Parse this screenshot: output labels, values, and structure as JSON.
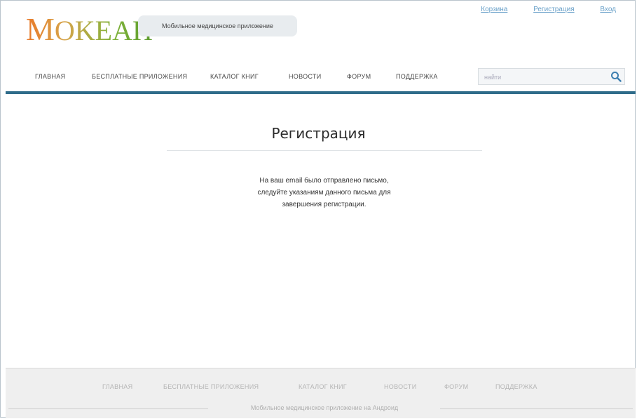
{
  "header": {
    "logo_first": "M",
    "logo_rest": "OKEAH",
    "tagline": "Мобильное медицинское приложение",
    "top_links": [
      "Корзина",
      "Регистрация",
      "Вход"
    ],
    "nav": [
      "ГЛАВНАЯ",
      "БЕСПЛАТНЫЕ ПРИЛОЖЕНИЯ",
      "КАТАЛОГ КНИГ",
      "НОВОСТИ",
      "ФОРУМ",
      "ПОДДЕРЖКА"
    ],
    "search_placeholder": "найти",
    "accent_color": "#2f6c8a"
  },
  "main": {
    "title": "Регистрация",
    "message_lines": [
      "На ваш email было отправлено письмо,",
      "следуйте указаниям данного письма для",
      "завершения регистрации."
    ]
  },
  "footer": {
    "nav": [
      "ГЛАВНАЯ",
      "БЕСПЛАТНЫЕ ПРИЛОЖЕНИЯ",
      "КАТАЛОГ КНИГ",
      "НОВОСТИ",
      "ФОРУМ",
      "ПОДДЕРЖКА"
    ],
    "tagline": "Мобильное медицинское приложение на Андроид"
  },
  "icons": {
    "search": "search-icon"
  }
}
